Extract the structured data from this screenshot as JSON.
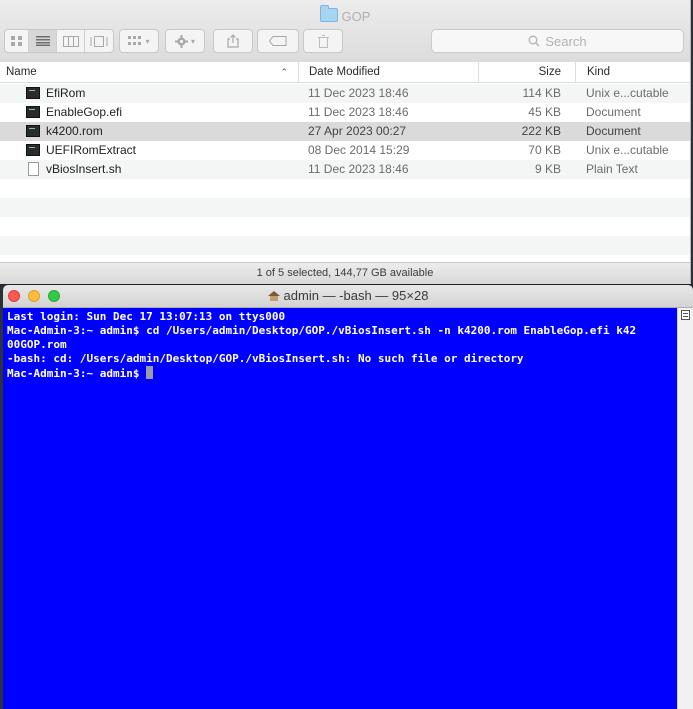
{
  "finder": {
    "title": "GOP",
    "search_placeholder": "Search",
    "columns": {
      "name": "Name",
      "date_modified": "Date Modified",
      "size": "Size",
      "kind": "Kind"
    },
    "files": [
      {
        "name": "EfiRom",
        "date": "11 Dec 2023 18:46",
        "size": "114 KB",
        "kind": "Unix e...cutable",
        "icon": "executable-icon"
      },
      {
        "name": "EnableGop.efi",
        "date": "11 Dec 2023 18:46",
        "size": "45 KB",
        "kind": "Document",
        "icon": "executable-icon"
      },
      {
        "name": "k4200.rom",
        "date": "27 Apr 2023 00:27",
        "size": "222 KB",
        "kind": "Document",
        "icon": "executable-icon"
      },
      {
        "name": "UEFIRomExtract",
        "date": "08 Dec 2014 15:29",
        "size": "70 KB",
        "kind": "Unix e...cutable",
        "icon": "executable-icon"
      },
      {
        "name": "vBiosInsert.sh",
        "date": "11 Dec 2023 18:46",
        "size": "9 KB",
        "kind": "Plain Text",
        "icon": "text-document-icon"
      }
    ],
    "selected_index": 2,
    "status": "1 of 5 selected, 144,77 GB available"
  },
  "terminal": {
    "title": "admin — -bash — 95×28",
    "background_color": "#0000fe",
    "lines": [
      "Last login: Sun Dec 17 13:07:13 on ttys000",
      "Mac-Admin-3:~ admin$ cd /Users/admin/Desktop/GOP./vBiosInsert.sh -n k4200.rom EnableGop.efi k42",
      "00GOP.rom",
      "-bash: cd: /Users/admin/Desktop/GOP./vBiosInsert.sh: No such file or directory"
    ],
    "prompt": "Mac-Admin-3:~ admin$ "
  }
}
